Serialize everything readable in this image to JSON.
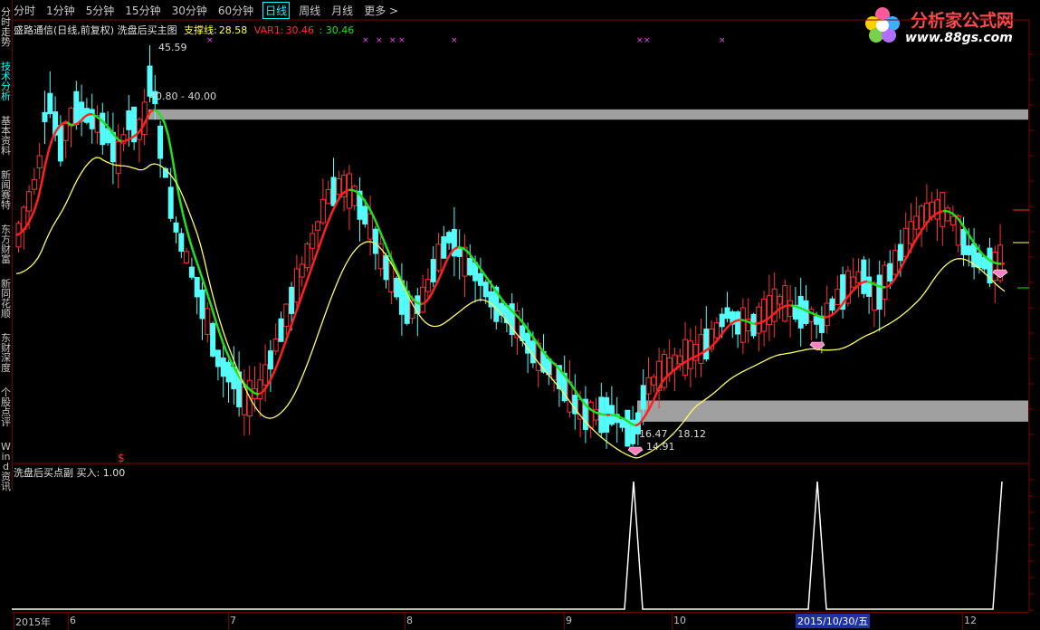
{
  "left_tabs": [
    {
      "label": "分时走势",
      "active": false
    },
    {
      "label": "技术分析",
      "active": true
    },
    {
      "label": "基本资料",
      "active": false
    },
    {
      "label": "新闻赛特",
      "active": false
    },
    {
      "label": "东方财富",
      "active": false
    },
    {
      "label": "新同花顺",
      "active": false
    },
    {
      "label": "东财深度",
      "active": false
    },
    {
      "label": "个股点评",
      "active": false
    },
    {
      "label": "Wind资讯",
      "active": false
    }
  ],
  "periods": [
    {
      "label": "分时",
      "active": false
    },
    {
      "label": "1分钟",
      "active": false
    },
    {
      "label": "5分钟",
      "active": false
    },
    {
      "label": "15分钟",
      "active": false
    },
    {
      "label": "30分钟",
      "active": false
    },
    {
      "label": "60分钟",
      "active": false
    },
    {
      "label": "日线",
      "active": true
    },
    {
      "label": "周线",
      "active": false
    },
    {
      "label": "月线",
      "active": false
    },
    {
      "label": "更多 >",
      "active": false
    }
  ],
  "logo": {
    "name": "分析家公式网",
    "url": "www.88gs.com"
  },
  "info": {
    "title": "盛路通信(日线,前复权) 洗盘后买主图",
    "support_label": "支撑线:",
    "support_value": "28.58",
    "var1_label": "VAR1:",
    "var1_value": "30.46",
    "var2_value": ": 30.46"
  },
  "annotations": {
    "high_label": "45.59",
    "upper_zone_label": "40.80 - 40.00",
    "lower_zone_label": "16.47 - 18.12",
    "low_label": "14.91",
    "dollar": "$"
  },
  "sub_chart": {
    "label": "洗盘后买点副 买入: 1.00"
  },
  "x_axis": {
    "labels": [
      "2015年",
      "6",
      "7",
      "8",
      "9",
      "10",
      "12"
    ],
    "highlight": "2015/10/30/五"
  },
  "colors": {
    "up": "#ff3232",
    "down": "#54fcfc",
    "ma_up": "#ff2020",
    "ma_down": "#20e020",
    "support": "#ffff60",
    "zone": "#a0a0a0",
    "signal": "#ffffff"
  },
  "chart_data": {
    "type": "candlestick",
    "title": "盛路通信(日线,前复权) 洗盘后买主图",
    "price_range": [
      13.5,
      46.5
    ],
    "high": 45.59,
    "low": 14.91,
    "zones": [
      {
        "label": "40.80 - 40.00",
        "low": 40.0,
        "high": 40.8
      },
      {
        "label": "16.47 - 18.12",
        "low": 16.47,
        "high": 18.12
      }
    ],
    "indicator_values": {
      "support": 28.58,
      "var1": 30.46
    },
    "sub_series": {
      "name": "买入",
      "value": 1.0
    }
  }
}
